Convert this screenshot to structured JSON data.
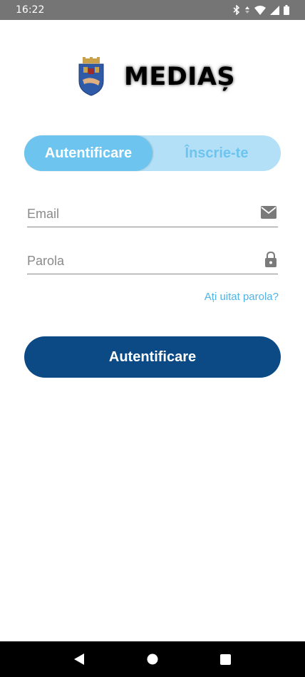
{
  "status_bar": {
    "time": "16:22",
    "icons": [
      "bluetooth-icon",
      "data-arrows-icon",
      "wifi-icon",
      "signal-icon",
      "battery-icon"
    ]
  },
  "header": {
    "brand": "MEDIAȘ",
    "crest_icon": "city-crest-icon"
  },
  "tabs": {
    "login_label": "Autentificare",
    "register_label": "Înscrie-te"
  },
  "form": {
    "email_placeholder": "Email",
    "email_value": "",
    "email_icon": "mail-icon",
    "password_placeholder": "Parola",
    "password_value": "",
    "password_icon": "lock-icon",
    "forgot_label": "Ați uitat parola?",
    "submit_label": "Autentificare"
  },
  "nav_bar": {
    "icons": [
      "back-icon",
      "home-icon",
      "recents-icon"
    ]
  },
  "colors": {
    "primary": "#0b4a84",
    "accent": "#6cc4ef",
    "accent_light": "#b3e0f7",
    "link": "#4fb3e8",
    "status_bar": "#757575"
  }
}
